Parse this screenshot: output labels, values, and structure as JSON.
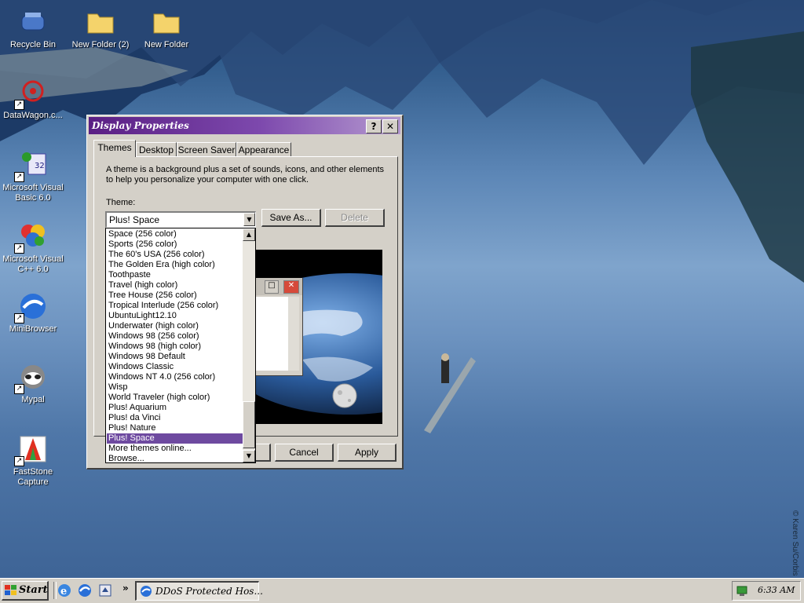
{
  "desktop": {
    "icons": [
      {
        "label": "Recycle Bin",
        "icon": "recycle-bin-icon"
      },
      {
        "label": "New Folder (2)",
        "icon": "folder-icon"
      },
      {
        "label": "New Folder",
        "icon": "folder-icon"
      },
      {
        "label": "DataWagon.c...",
        "icon": "datawagon-icon"
      },
      {
        "label": "Microsoft Visual Basic 6.0",
        "icon": "visual-basic-icon"
      },
      {
        "label": "Microsoft Visual C++ 6.0",
        "icon": "visual-cpp-icon"
      },
      {
        "label": "MiniBrowser",
        "icon": "minibrowser-icon"
      },
      {
        "label": "Mypal",
        "icon": "mypal-icon"
      },
      {
        "label": "FastStone Capture",
        "icon": "faststone-capture-icon"
      }
    ],
    "watermark": "© Karen Su/Corbis"
  },
  "window": {
    "title": "Display Properties",
    "help_btn": "?",
    "close_btn": "✕",
    "tabs": [
      "Themes",
      "Desktop",
      "Screen Saver",
      "Appearance"
    ],
    "description": "A theme is a background plus a set of sounds, icons, and other elements to help you personalize your computer with one click.",
    "theme_label": "Theme:",
    "theme_value": "Plus! Space",
    "save_as": "Save As...",
    "delete": "Delete",
    "cancel": "Cancel",
    "apply": "Apply",
    "dropdown_items": [
      "Space (256 color)",
      "Sports (256 color)",
      "The 60's USA (256 color)",
      "The Golden Era (high color)",
      "Toothpaste",
      "Travel (high color)",
      "Tree House (256 color)",
      "Tropical Interlude (256 color)",
      "UbuntuLight12.10",
      "Underwater (high color)",
      "Windows 98 (256 color)",
      "Windows 98 (high color)",
      "Windows 98 Default",
      "Windows Classic",
      "Windows NT 4.0 (256 color)",
      "Wisp",
      "World Traveler (high color)",
      "Plus! Aquarium",
      "Plus! da Vinci",
      "Plus! Nature",
      "Plus! Space",
      "More themes online...",
      "Browse..."
    ],
    "selected_item": "Plus! Space"
  },
  "taskbar": {
    "start": "Start",
    "task_title": "DDoS Protected Hos...",
    "chevron": "»",
    "clock": "6:33 AM"
  },
  "colors": {
    "title_start": "#5a1f84",
    "title_end": "#b59ad0",
    "selection": "#6e4aa0",
    "face": "#d4d0c8"
  }
}
